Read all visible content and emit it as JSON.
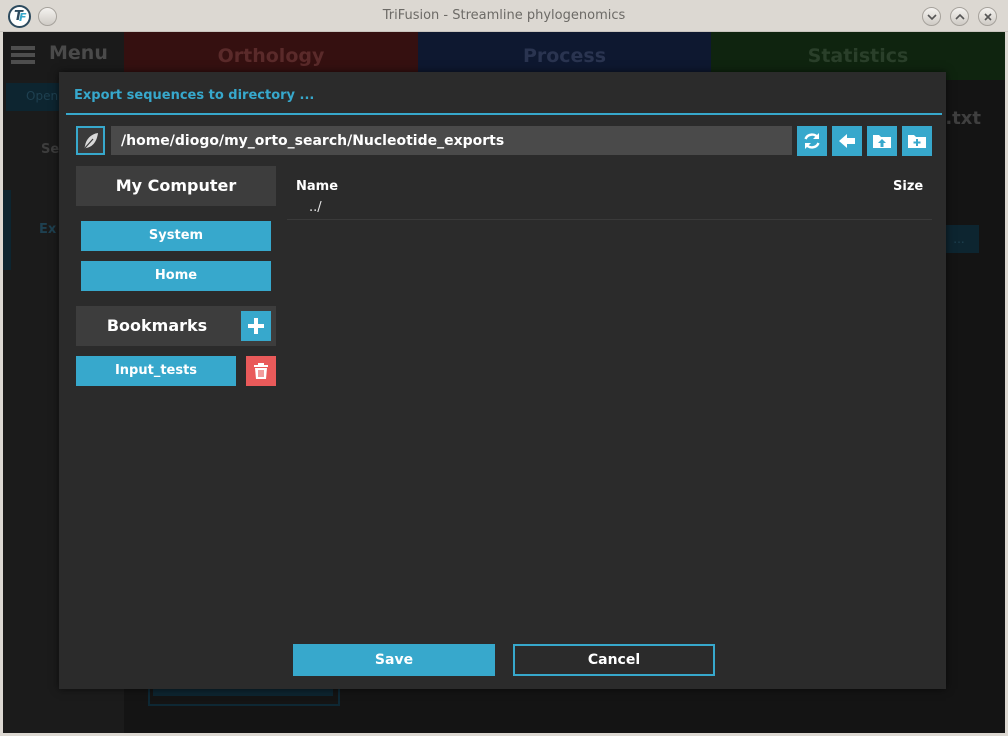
{
  "window": {
    "title": "TriFusion - Streamline phylogenomics",
    "logo_text": "TF"
  },
  "app": {
    "menu_label": "Menu",
    "tabs": [
      {
        "label": "Orthology",
        "color": "#351010"
      },
      {
        "label": "Process",
        "color": "#0e1830"
      },
      {
        "label": "Statistics",
        "color": "#0f240f"
      }
    ],
    "side_open_label": "Open",
    "side_se_label": "Se",
    "side_ex_label": "Ex",
    "right_ext_label": ".txt",
    "right_btn_label": "..."
  },
  "dialog": {
    "title": "Export sequences to directory ...",
    "path": "/home/diogo/my_orto_search/Nucleotide_exports",
    "tools": [
      {
        "icon": "refresh-icon"
      },
      {
        "icon": "arrow-left-icon"
      },
      {
        "icon": "folder-up-icon"
      },
      {
        "icon": "folder-plus-icon"
      }
    ],
    "my_computer_label": "My Computer",
    "system_label": "System",
    "home_label": "Home",
    "bookmarks_label": "Bookmarks",
    "bookmarks": [
      {
        "label": "Input_tests"
      }
    ],
    "columns": {
      "name": "Name",
      "size": "Size"
    },
    "files": [
      {
        "name": "../"
      }
    ],
    "save_label": "Save",
    "cancel_label": "Cancel"
  },
  "colors": {
    "accent": "#37a8cc",
    "danger": "#e95a5a",
    "dialog_bg": "#2b2b2b"
  }
}
